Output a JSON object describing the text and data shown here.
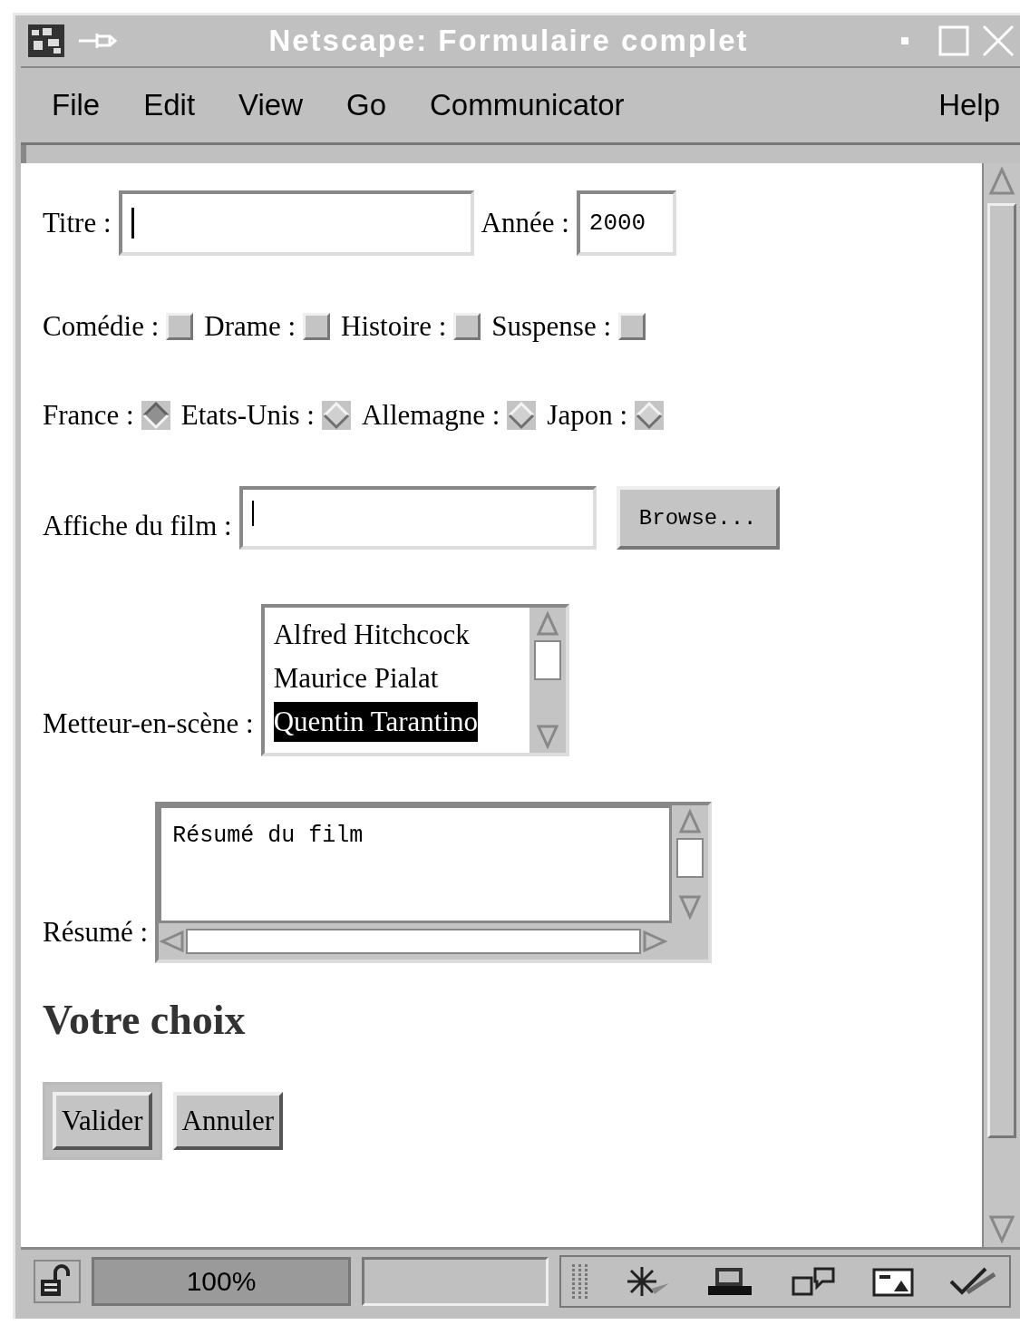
{
  "window": {
    "title": "Netscape: Formulaire complet"
  },
  "menu": [
    {
      "label": "File"
    },
    {
      "label": "Edit"
    },
    {
      "label": "View"
    },
    {
      "label": "Go"
    },
    {
      "label": "Communicator"
    },
    {
      "label": "Help"
    }
  ],
  "form": {
    "title_field": {
      "label": "Titre :"
    },
    "year_field": {
      "label": "Année :",
      "value": "2000"
    },
    "genres": [
      {
        "label": "Comédie :",
        "checked": false
      },
      {
        "label": "Drame :",
        "checked": false
      },
      {
        "label": "Histoire :",
        "checked": false
      },
      {
        "label": "Suspense :",
        "checked": false
      }
    ],
    "countries": [
      {
        "label": "France :",
        "selected": true
      },
      {
        "label": "Etats-Unis :",
        "selected": false
      },
      {
        "label": "Allemagne :",
        "selected": false
      },
      {
        "label": "Japon :",
        "selected": false
      }
    ],
    "poster": {
      "label": "Affiche du film :",
      "button": "Browse..."
    },
    "director": {
      "label": "Metteur-en-scène :",
      "options": [
        {
          "label": "Alfred Hitchcock",
          "selected": false
        },
        {
          "label": "Maurice Pialat",
          "selected": false
        },
        {
          "label": "Quentin Tarantino",
          "selected": true
        }
      ]
    },
    "summary": {
      "label": "Résumé :",
      "value": "Résumé du film"
    },
    "heading": "Votre choix",
    "buttons": [
      {
        "label": "Valider",
        "default": true
      },
      {
        "label": "Annuler",
        "default": false
      }
    ]
  },
  "status_bar": {
    "zoom": "100%"
  }
}
